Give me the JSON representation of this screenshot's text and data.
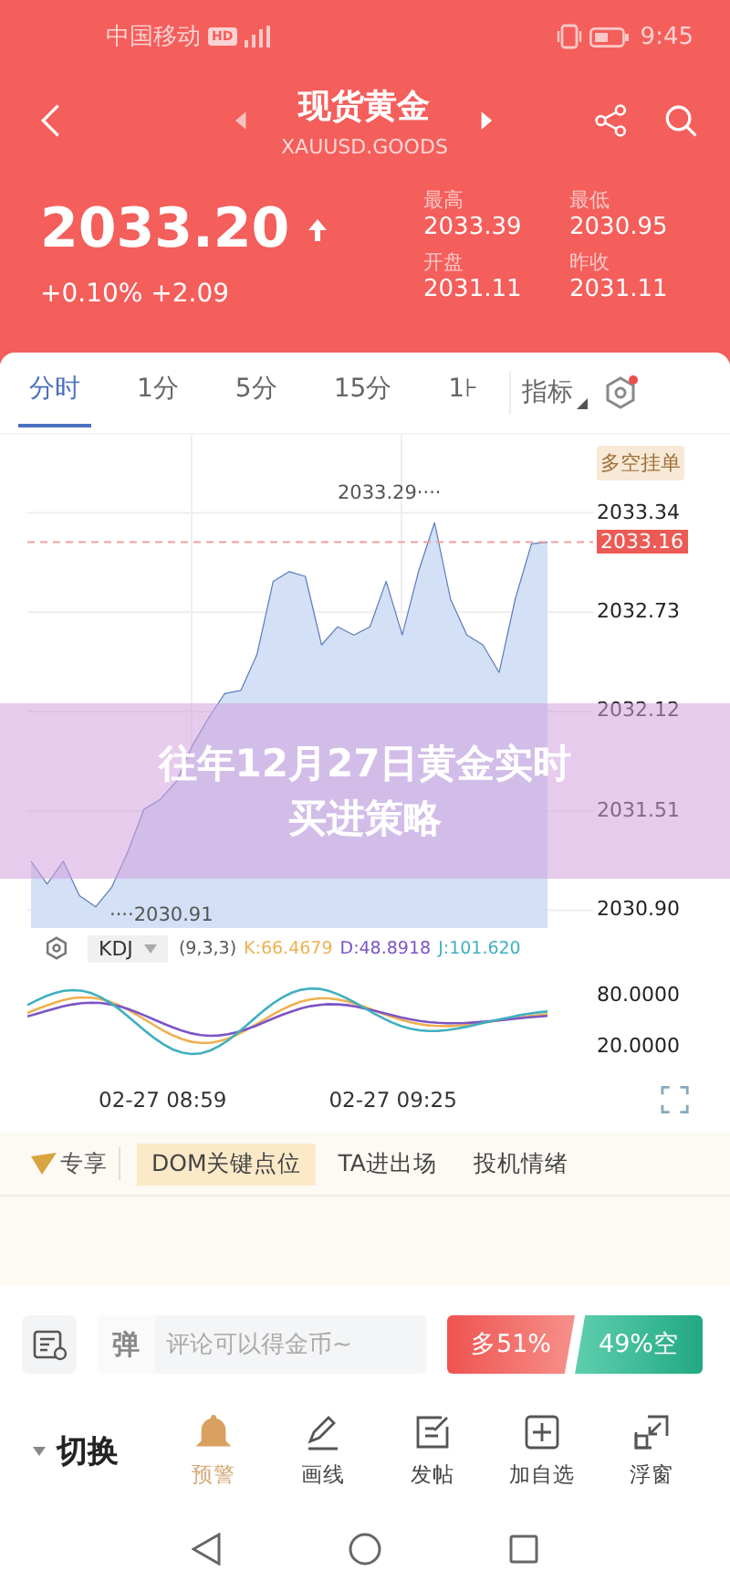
{
  "status_bar": {
    "carrier": "中国移动",
    "hd_badge": "HD",
    "time": "9:45"
  },
  "header": {
    "title": "现货黄金",
    "subtitle": "XAUUSD.GOODS"
  },
  "quote": {
    "price": "2033.20",
    "change": "+0.10% +2.09",
    "stats": [
      {
        "label": "最高",
        "value": "2033.39"
      },
      {
        "label": "最低",
        "value": "2030.95"
      },
      {
        "label": "开盘",
        "value": "2031.11"
      },
      {
        "label": "昨收",
        "value": "2031.11"
      }
    ]
  },
  "tabs": [
    {
      "label": "分时",
      "selected": true
    },
    {
      "label": "1分",
      "selected": false
    },
    {
      "label": "5分",
      "selected": false
    },
    {
      "label": "15分",
      "selected": false
    },
    {
      "label": "1⊦",
      "selected": false
    }
  ],
  "indicator_menu": "指标",
  "chart": {
    "order_button": "多空挂单",
    "high_label": "2033.29····",
    "low_label": "····2030.91",
    "chart_data": {
      "type": "area",
      "grid": true,
      "ylim": [
        2030.79,
        2033.82
      ],
      "ref_lines": [
        {
          "axis": "y",
          "value": 2033.16,
          "label": "2033.16",
          "color": "#f0a0a0"
        }
      ],
      "yticks": [
        {
          "value": 2030.9,
          "label": "2030.90"
        },
        {
          "value": 2031.51,
          "label": "2031.51"
        },
        {
          "value": 2032.12,
          "label": "2032.12"
        },
        {
          "value": 2032.73,
          "label": "2032.73"
        },
        {
          "value": 2033.34,
          "label": "2033.34"
        }
      ],
      "series": [
        {
          "color": "#5a7bbd",
          "values": [
            2031.2,
            2031.06,
            2031.2,
            2030.99,
            2030.92,
            2031.04,
            2031.26,
            2031.52,
            2031.58,
            2031.69,
            2031.91,
            2032.08,
            2032.23,
            2032.25,
            2032.47,
            2032.92,
            2032.98,
            2032.95,
            2032.53,
            2032.64,
            2032.59,
            2032.64,
            2032.92,
            2032.59,
            2032.98,
            2033.28,
            2032.81,
            2032.59,
            2032.53,
            2032.36,
            2032.81,
            2033.15,
            2033.16
          ]
        }
      ]
    }
  },
  "kdj": {
    "name": "KDJ",
    "params": "(9,3,3)",
    "values": [
      {
        "text": "K:66.4679",
        "color": "#f0b050"
      },
      {
        "text": "D:48.8918",
        "color": "#7b55c6"
      },
      {
        "text": "J:101.620",
        "color": "#3fb0c0"
      }
    ],
    "y_labels": [
      "80.0000",
      "20.0000"
    ],
    "x_labels": [
      "02-27 08:59",
      "02-27 09:25"
    ]
  },
  "exclusive": {
    "label": "专享",
    "items": [
      {
        "label": "DOM关键点位",
        "selected": true
      },
      {
        "label": "TA进出场",
        "selected": false
      },
      {
        "label": "投机情绪",
        "selected": false
      }
    ]
  },
  "comment": {
    "danmaku": "弹",
    "placeholder": "评论可以得金币~"
  },
  "sentiment": {
    "bull": "多51%",
    "bear": "49%空"
  },
  "toolbar": {
    "switch": "切换",
    "items": [
      {
        "label": "预警",
        "kind": "bell",
        "selected": true
      },
      {
        "label": "画线",
        "kind": "pen",
        "selected": false
      },
      {
        "label": "发帖",
        "kind": "post",
        "selected": false
      },
      {
        "label": "加自选",
        "kind": "add",
        "selected": false
      },
      {
        "label": "浮窗",
        "kind": "float",
        "selected": false
      }
    ]
  },
  "banner": {
    "title": "往年12月27日黄金实时买进策略"
  }
}
